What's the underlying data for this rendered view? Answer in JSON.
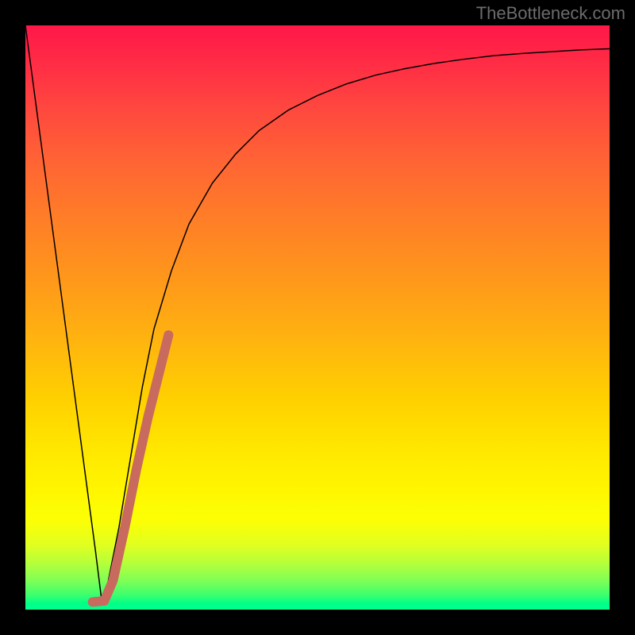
{
  "watermark": "TheBottleneck.com",
  "chart_data": {
    "type": "line",
    "title": "",
    "xlabel": "",
    "ylabel": "",
    "xlim": [
      0,
      100
    ],
    "ylim": [
      0,
      100
    ],
    "grid": false,
    "series": [
      {
        "name": "main-curve",
        "color": "#000000",
        "stroke_width": 1.5,
        "x": [
          0,
          2,
          4,
          6,
          8,
          10,
          12,
          13,
          14,
          16,
          18,
          20,
          22,
          25,
          28,
          32,
          36,
          40,
          45,
          50,
          55,
          60,
          65,
          70,
          75,
          80,
          85,
          90,
          95,
          100
        ],
        "y": [
          100,
          85,
          70,
          55,
          40,
          25,
          10,
          2,
          4,
          14,
          26,
          38,
          48,
          58,
          66,
          73,
          78,
          82,
          85.5,
          88,
          90,
          91.5,
          92.6,
          93.5,
          94.2,
          94.8,
          95.2,
          95.5,
          95.8,
          96
        ]
      },
      {
        "name": "highlight-segment",
        "color": "#c96a5e",
        "stroke_width": 12,
        "x": [
          13.5,
          15,
          17,
          19,
          21,
          23,
          24.5
        ],
        "y": [
          1.5,
          5,
          14,
          24,
          33,
          41,
          47
        ]
      },
      {
        "name": "highlight-base",
        "color": "#c96a5e",
        "stroke_width": 12,
        "x": [
          11.5,
          13.5
        ],
        "y": [
          1.3,
          1.5
        ]
      }
    ],
    "background_gradient": {
      "top": "#ff1748",
      "mid": "#ffe800",
      "bottom": "#00ff88"
    }
  }
}
